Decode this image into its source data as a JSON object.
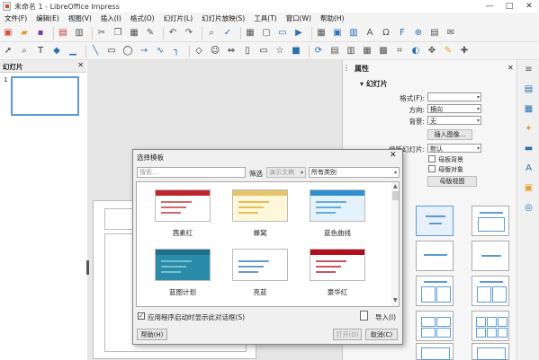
{
  "window": {
    "title": "未命名 1 - LibreOffice Impress",
    "buttons": [
      "—",
      "□",
      "✕"
    ]
  },
  "menu": [
    "文件(F)",
    "编辑(E)",
    "视图(V)",
    "插入(I)",
    "格式(O)",
    "幻灯片(L)",
    "幻灯片放映(S)",
    "工具(T)",
    "窗口(W)",
    "帮助(H)"
  ],
  "slides_panel": {
    "title": "幻灯片",
    "close": "✕",
    "slide_number": "1"
  },
  "properties": {
    "title": "属性",
    "close": "✕",
    "section": "幻灯片",
    "format_label": "格式(F):",
    "format_value": "",
    "orientation_label": "方向:",
    "orientation_value": "横向",
    "background_label": "背景:",
    "background_value": "无",
    "insert_image": "插入图像...",
    "master_label": "母版幻灯片:",
    "master_value": "默认",
    "master_background": "母板背景",
    "master_objects": "母版对象",
    "master_view": "母版视图"
  },
  "dialog": {
    "title": "选择模板",
    "close": "✕",
    "search_placeholder": "搜索...",
    "filter_label": "筛选",
    "filter_value": "演示文稿",
    "category_value": "所有类别",
    "templates": [
      {
        "name": "茜素红",
        "top": "#c0272d",
        "bg": "#ffffff",
        "accent": "#c0272d"
      },
      {
        "name": "蜂窝",
        "top": "#e5c46a",
        "bg": "#fff7d9",
        "accent": "#d9a520"
      },
      {
        "name": "蓝色曲线",
        "top": "#2f8fd1",
        "bg": "#e3f2fb",
        "accent": "#2f8fd1"
      },
      {
        "name": "蓝图计划",
        "top": "#1f6f8b",
        "bg": "#2a8ca8",
        "accent": "#9fd3e3"
      },
      {
        "name": "亮蓝",
        "top": "#ffffff",
        "bg": "#ffffff",
        "accent": "#2a6fb0"
      },
      {
        "name": "豪华红",
        "top": "#b10e1e",
        "bg": "#ffffff",
        "accent": "#b10e1e"
      }
    ],
    "show_on_startup": "应用程序启动时显示此对话框(S)",
    "show_on_startup_checked": true,
    "import": "导入(I)",
    "help": "帮助(H)",
    "open": "打开(O)",
    "cancel": "取消(C)"
  }
}
